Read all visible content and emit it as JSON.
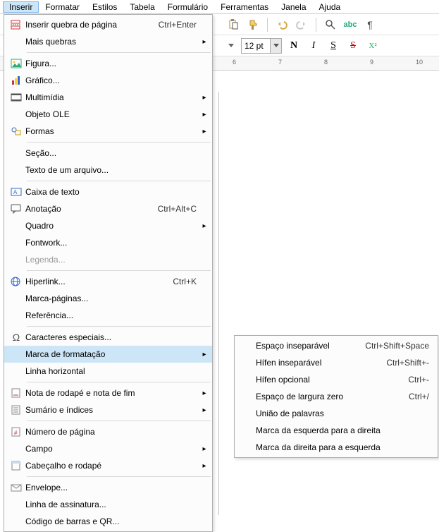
{
  "menubar": {
    "items": [
      "Inserir",
      "Formatar",
      "Estilos",
      "Tabela",
      "Formulário",
      "Ferramentas",
      "Janela",
      "Ajuda"
    ],
    "active_index": 0
  },
  "toolbar": {
    "font_size": "12 pt",
    "bold": "N",
    "italic": "I",
    "underline": "S",
    "strike": "S",
    "superscript": "X²"
  },
  "ruler": {
    "marks": [
      "6",
      "7",
      "8",
      "9",
      "10"
    ]
  },
  "menu_insert": {
    "items": [
      {
        "icon": "page-break-icon",
        "label": "Inserir quebra de página",
        "accel": "Ctrl+Enter",
        "sub": false
      },
      {
        "icon": "",
        "label": "Mais quebras",
        "accel": "",
        "sub": true
      },
      {
        "sep": true
      },
      {
        "icon": "image-icon",
        "label": "Figura...",
        "accel": "",
        "sub": false
      },
      {
        "icon": "chart-icon",
        "label": "Gráfico...",
        "accel": "",
        "sub": false
      },
      {
        "icon": "media-icon",
        "label": "Multimídia",
        "accel": "",
        "sub": true
      },
      {
        "icon": "",
        "label": "Objeto OLE",
        "accel": "",
        "sub": true
      },
      {
        "icon": "shapes-icon",
        "label": "Formas",
        "accel": "",
        "sub": true
      },
      {
        "sep": true
      },
      {
        "icon": "",
        "label": "Seção...",
        "accel": "",
        "sub": false
      },
      {
        "icon": "",
        "label": "Texto de um arquivo...",
        "accel": "",
        "sub": false
      },
      {
        "sep": true
      },
      {
        "icon": "textbox-icon",
        "label": "Caixa de texto",
        "accel": "",
        "sub": false
      },
      {
        "icon": "comment-icon",
        "label": "Anotação",
        "accel": "Ctrl+Alt+C",
        "sub": false
      },
      {
        "icon": "",
        "label": "Quadro",
        "accel": "",
        "sub": true
      },
      {
        "icon": "",
        "label": "Fontwork...",
        "accel": "",
        "sub": false
      },
      {
        "icon": "",
        "label": "Legenda...",
        "accel": "",
        "sub": false,
        "disabled": true
      },
      {
        "sep": true
      },
      {
        "icon": "globe-icon",
        "label": "Hiperlink...",
        "accel": "Ctrl+K",
        "sub": false
      },
      {
        "icon": "",
        "label": "Marca-páginas...",
        "accel": "",
        "sub": false
      },
      {
        "icon": "",
        "label": "Referência...",
        "accel": "",
        "sub": false
      },
      {
        "sep": true
      },
      {
        "icon": "omega-icon",
        "label": "Caracteres especiais...",
        "accel": "",
        "sub": false
      },
      {
        "icon": "",
        "label": "Marca de formatação",
        "accel": "",
        "sub": true,
        "highlight": true
      },
      {
        "icon": "",
        "label": "Linha horizontal",
        "accel": "",
        "sub": false
      },
      {
        "sep": true
      },
      {
        "icon": "footnote-icon",
        "label": "Nota de rodapé e nota de fim",
        "accel": "",
        "sub": true
      },
      {
        "icon": "toc-icon",
        "label": "Sumário e índices",
        "accel": "",
        "sub": true
      },
      {
        "sep": true
      },
      {
        "icon": "pagenum-icon",
        "label": "Número de página",
        "accel": "",
        "sub": false
      },
      {
        "icon": "",
        "label": "Campo",
        "accel": "",
        "sub": true
      },
      {
        "icon": "header-icon",
        "label": "Cabeçalho e rodapé",
        "accel": "",
        "sub": true
      },
      {
        "sep": true
      },
      {
        "icon": "envelope-icon",
        "label": "Envelope...",
        "accel": "",
        "sub": false
      },
      {
        "icon": "",
        "label": "Linha de assinatura...",
        "accel": "",
        "sub": false
      },
      {
        "icon": "",
        "label": "Código de barras e QR...",
        "accel": "",
        "sub": false
      }
    ]
  },
  "menu_sub": {
    "items": [
      {
        "label": "Espaço inseparável",
        "accel": "Ctrl+Shift+Space"
      },
      {
        "label": "Hífen inseparável",
        "accel": "Ctrl+Shift+-"
      },
      {
        "label": "Hífen opcional",
        "accel": "Ctrl+-"
      },
      {
        "label": "Espaço de largura zero",
        "accel": "Ctrl+/"
      },
      {
        "label": "União de palavras",
        "accel": ""
      },
      {
        "label": "Marca da esquerda para a direita",
        "accel": ""
      },
      {
        "label": "Marca da direita para a esquerda",
        "accel": ""
      }
    ]
  }
}
